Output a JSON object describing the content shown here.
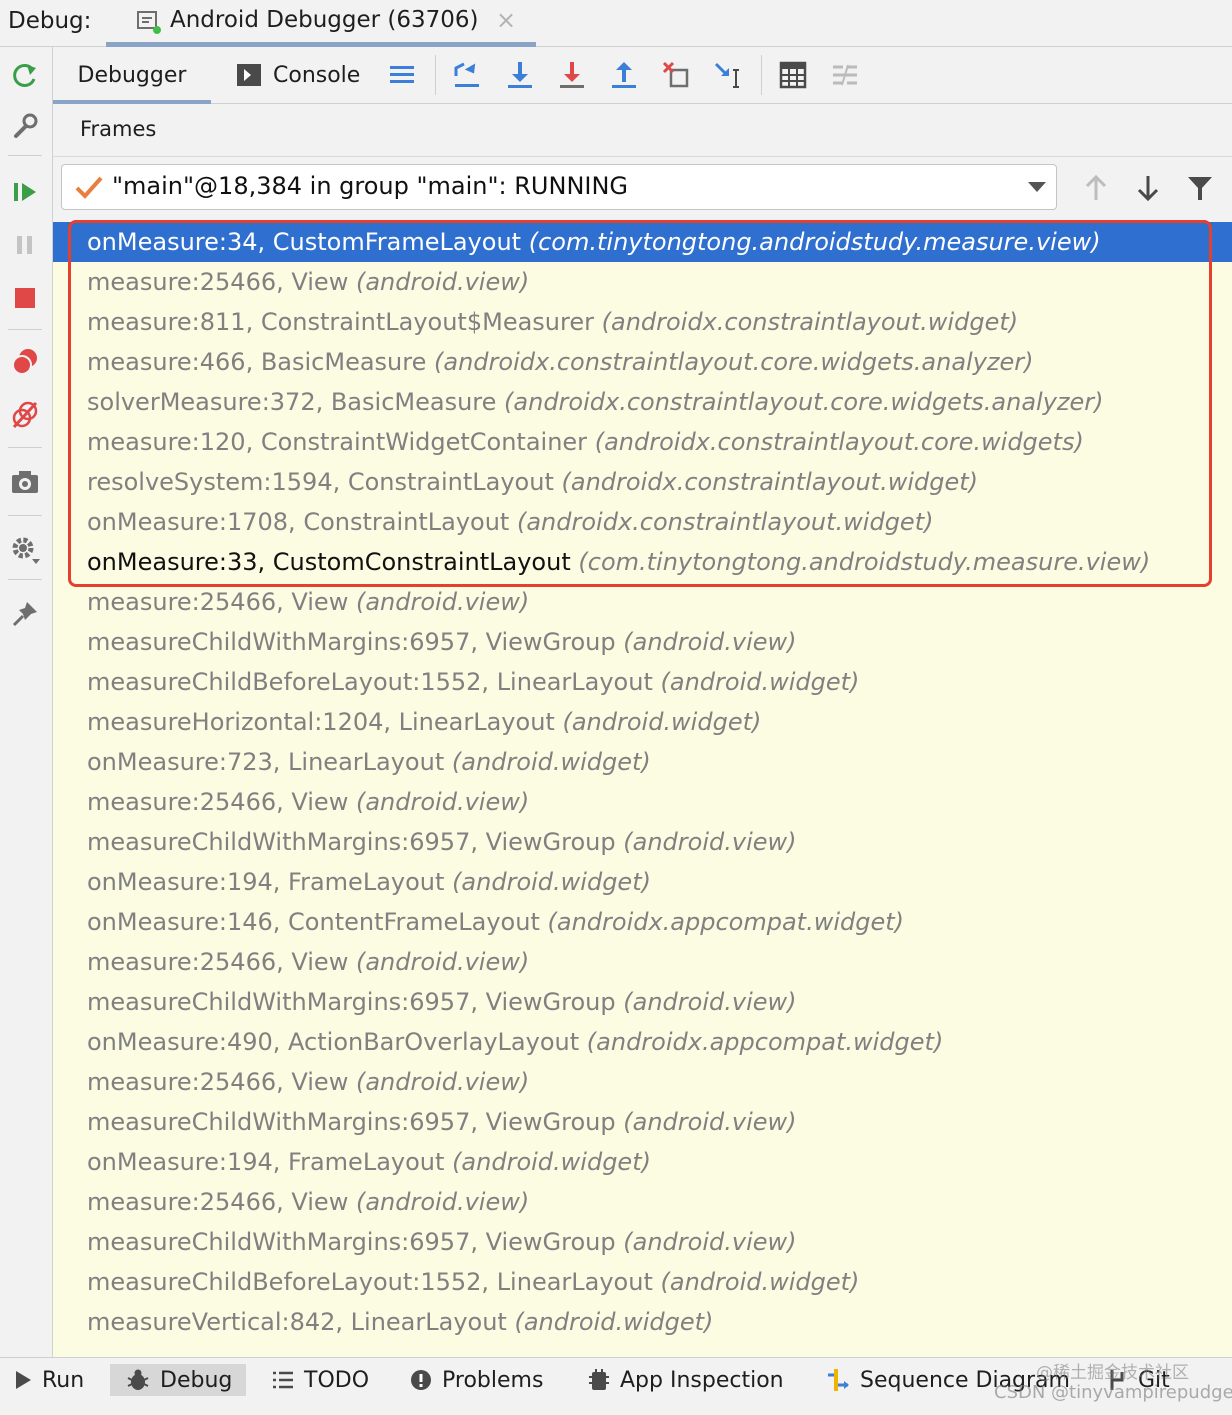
{
  "top": {
    "label": "Debug:",
    "session_title": "Android Debugger (63706)",
    "close_glyph": "×"
  },
  "toolbar": {
    "debugger_tab": "Debugger",
    "console_tab": "Console"
  },
  "frames_header": "Frames",
  "thread": {
    "value": "\"main\"@18,384 in group \"main\": RUNNING"
  },
  "frames": [
    {
      "m": "onMeasure:34, CustomFrameLayout",
      "p": "(com.tinytongtong.androidstudy.measure.view)"
    },
    {
      "m": "measure:25466, View",
      "p": "(android.view)"
    },
    {
      "m": "measure:811, ConstraintLayout$Measurer",
      "p": "(androidx.constraintlayout.widget)"
    },
    {
      "m": "measure:466, BasicMeasure",
      "p": "(androidx.constraintlayout.core.widgets.analyzer)"
    },
    {
      "m": "solverMeasure:372, BasicMeasure",
      "p": "(androidx.constraintlayout.core.widgets.analyzer)"
    },
    {
      "m": "measure:120, ConstraintWidgetContainer",
      "p": "(androidx.constraintlayout.core.widgets)"
    },
    {
      "m": "resolveSystem:1594, ConstraintLayout",
      "p": "(androidx.constraintlayout.widget)"
    },
    {
      "m": "onMeasure:1708, ConstraintLayout",
      "p": "(androidx.constraintlayout.widget)"
    },
    {
      "m": "onMeasure:33, CustomConstraintLayout",
      "p": "(com.tinytongtong.androidstudy.measure.view)"
    },
    {
      "m": "measure:25466, View",
      "p": "(android.view)"
    },
    {
      "m": "measureChildWithMargins:6957, ViewGroup",
      "p": "(android.view)"
    },
    {
      "m": "measureChildBeforeLayout:1552, LinearLayout",
      "p": "(android.widget)"
    },
    {
      "m": "measureHorizontal:1204, LinearLayout",
      "p": "(android.widget)"
    },
    {
      "m": "onMeasure:723, LinearLayout",
      "p": "(android.widget)"
    },
    {
      "m": "measure:25466, View",
      "p": "(android.view)"
    },
    {
      "m": "measureChildWithMargins:6957, ViewGroup",
      "p": "(android.view)"
    },
    {
      "m": "onMeasure:194, FrameLayout",
      "p": "(android.widget)"
    },
    {
      "m": "onMeasure:146, ContentFrameLayout",
      "p": "(androidx.appcompat.widget)"
    },
    {
      "m": "measure:25466, View",
      "p": "(android.view)"
    },
    {
      "m": "measureChildWithMargins:6957, ViewGroup",
      "p": "(android.view)"
    },
    {
      "m": "onMeasure:490, ActionBarOverlayLayout",
      "p": "(androidx.appcompat.widget)"
    },
    {
      "m": "measure:25466, View",
      "p": "(android.view)"
    },
    {
      "m": "measureChildWithMargins:6957, ViewGroup",
      "p": "(android.view)"
    },
    {
      "m": "onMeasure:194, FrameLayout",
      "p": "(android.widget)"
    },
    {
      "m": "measure:25466, View",
      "p": "(android.view)"
    },
    {
      "m": "measureChildWithMargins:6957, ViewGroup",
      "p": "(android.view)"
    },
    {
      "m": "measureChildBeforeLayout:1552, LinearLayout",
      "p": "(android.widget)"
    },
    {
      "m": "measureVertical:842, LinearLayout",
      "p": "(android.widget)"
    }
  ],
  "bottom": {
    "run": "Run",
    "debug": "Debug",
    "todo": "TODO",
    "problems": "Problems",
    "app_inspection": "App Inspection",
    "sequence_diagram": "Sequence Diagram",
    "git": "Git"
  },
  "watermark": {
    "line1": "@稀土掘金技术社区",
    "line2": "CSDN @tinyvampirepudge"
  },
  "colors": {
    "selected_row": "#2e6fd0",
    "frames_bg": "#fcfce3",
    "highlight": "#e3402f",
    "accent_underline": "#8aa4c8"
  }
}
